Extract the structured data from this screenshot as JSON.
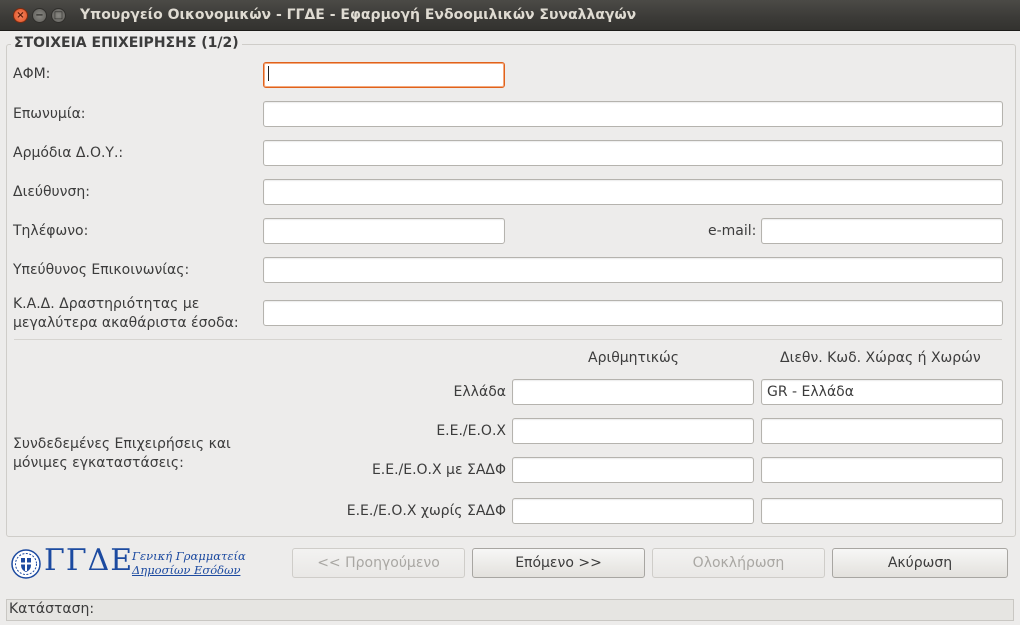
{
  "window": {
    "title": "Υπουργείο Οικονομικών - ΓΓΔΕ - Εφαρμογή Ενδοομιλικών Συναλλαγών",
    "controls": [
      "close-icon",
      "minimize-icon",
      "maximize-icon"
    ]
  },
  "section": {
    "title": "ΣΤΟΙΧΕΙΑ ΕΠΙΧΕΙΡΗΣΗΣ (1/2)"
  },
  "form": {
    "afm_label": "ΑΦΜ:",
    "afm_value": "",
    "name_label": "Επωνυμία:",
    "name_value": "",
    "doy_label": "Αρμόδια Δ.Ο.Υ.:",
    "doy_value": "",
    "address_label": "Διεύθυνση:",
    "address_value": "",
    "phone_label": "Τηλέφωνο:",
    "phone_value": "",
    "email_label": "e-mail:",
    "email_value": "",
    "contact_label": "Υπεύθυνος Επικοινωνίας:",
    "contact_value": "",
    "kad_label_line1": "Κ.Α.Δ. Δραστηριότητας με",
    "kad_label_line2": "μεγαλύτερα ακαθάριστα έσοδα:",
    "kad_value": ""
  },
  "related": {
    "label_line1": "Συνδεδεμένες Επιχειρήσεις και",
    "label_line2": "μόνιμες εγκαταστάσεις:",
    "col_numeric": "Αριθμητικώς",
    "col_country": "Διεθν. Κωδ. Χώρας ή Χωρών",
    "rows": [
      {
        "label": "Ελλάδα",
        "numeric": "",
        "country": "GR - Ελλάδα"
      },
      {
        "label": "Ε.Ε./Ε.Ο.Χ",
        "numeric": "",
        "country": ""
      },
      {
        "label": "Ε.Ε./Ε.Ο.Χ με ΣΑΔΦ",
        "numeric": "",
        "country": ""
      },
      {
        "label": "Ε.Ε./Ε.Ο.Χ χωρίς ΣΑΔΦ",
        "numeric": "",
        "country": ""
      }
    ]
  },
  "logo": {
    "abbr": "ΓΓΔΕ",
    "line1": "Γενική Γραμματεία",
    "line2": "Δημοσίων Εσόδων"
  },
  "buttons": {
    "previous": "<< Προηγούμενο",
    "next": "Επόμενο >>",
    "finish": "Ολοκλήρωση",
    "cancel": "Ακύρωση"
  },
  "status": {
    "label": "Κατάσταση:"
  },
  "colors": {
    "focus_border": "#e0621c",
    "logo_blue": "#1c4aa0",
    "titlebar": "#3c3b37"
  }
}
